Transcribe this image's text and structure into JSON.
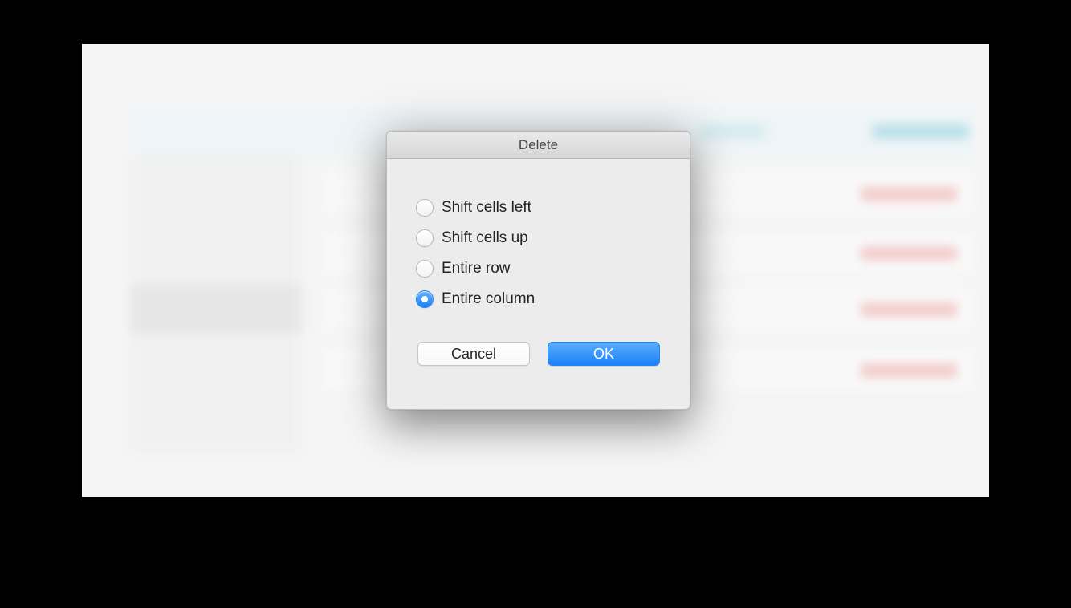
{
  "dialog": {
    "title": "Delete",
    "options": [
      {
        "label": "Shift cells left",
        "selected": false
      },
      {
        "label": "Shift cells up",
        "selected": false
      },
      {
        "label": "Entire row",
        "selected": false
      },
      {
        "label": "Entire column",
        "selected": true
      }
    ],
    "buttons": {
      "cancel": "Cancel",
      "ok": "OK"
    }
  }
}
